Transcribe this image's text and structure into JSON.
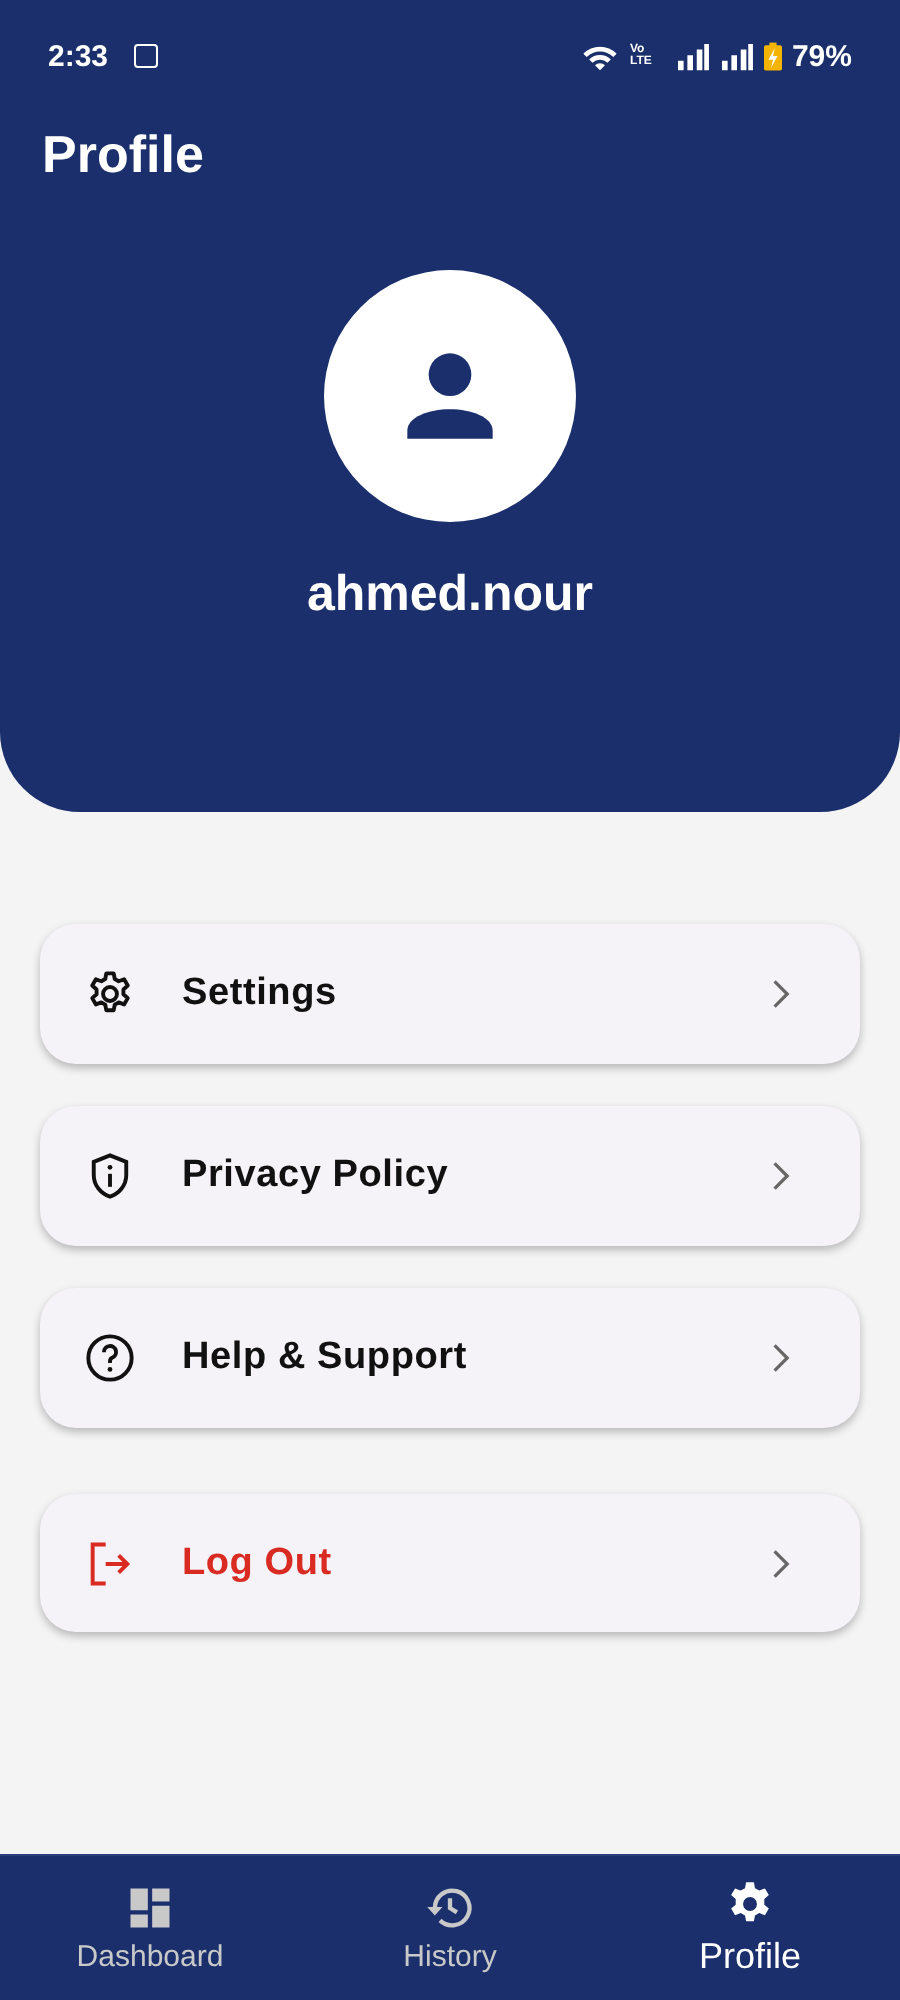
{
  "status_bar": {
    "time": "2:33",
    "network": "Vo LTE",
    "battery": "79%"
  },
  "header": {
    "title": "Profile",
    "username": "ahmed.nour"
  },
  "menu": [
    {
      "label": "Settings",
      "kind": "normal"
    },
    {
      "label": "Privacy Policy",
      "kind": "normal"
    },
    {
      "label": "Help & Support",
      "kind": "normal"
    },
    {
      "label": "Log Out",
      "kind": "danger"
    }
  ],
  "bottom_nav": [
    {
      "label": "Dashboard",
      "selected": false
    },
    {
      "label": "History",
      "selected": false
    },
    {
      "label": "Profile",
      "selected": true
    }
  ]
}
